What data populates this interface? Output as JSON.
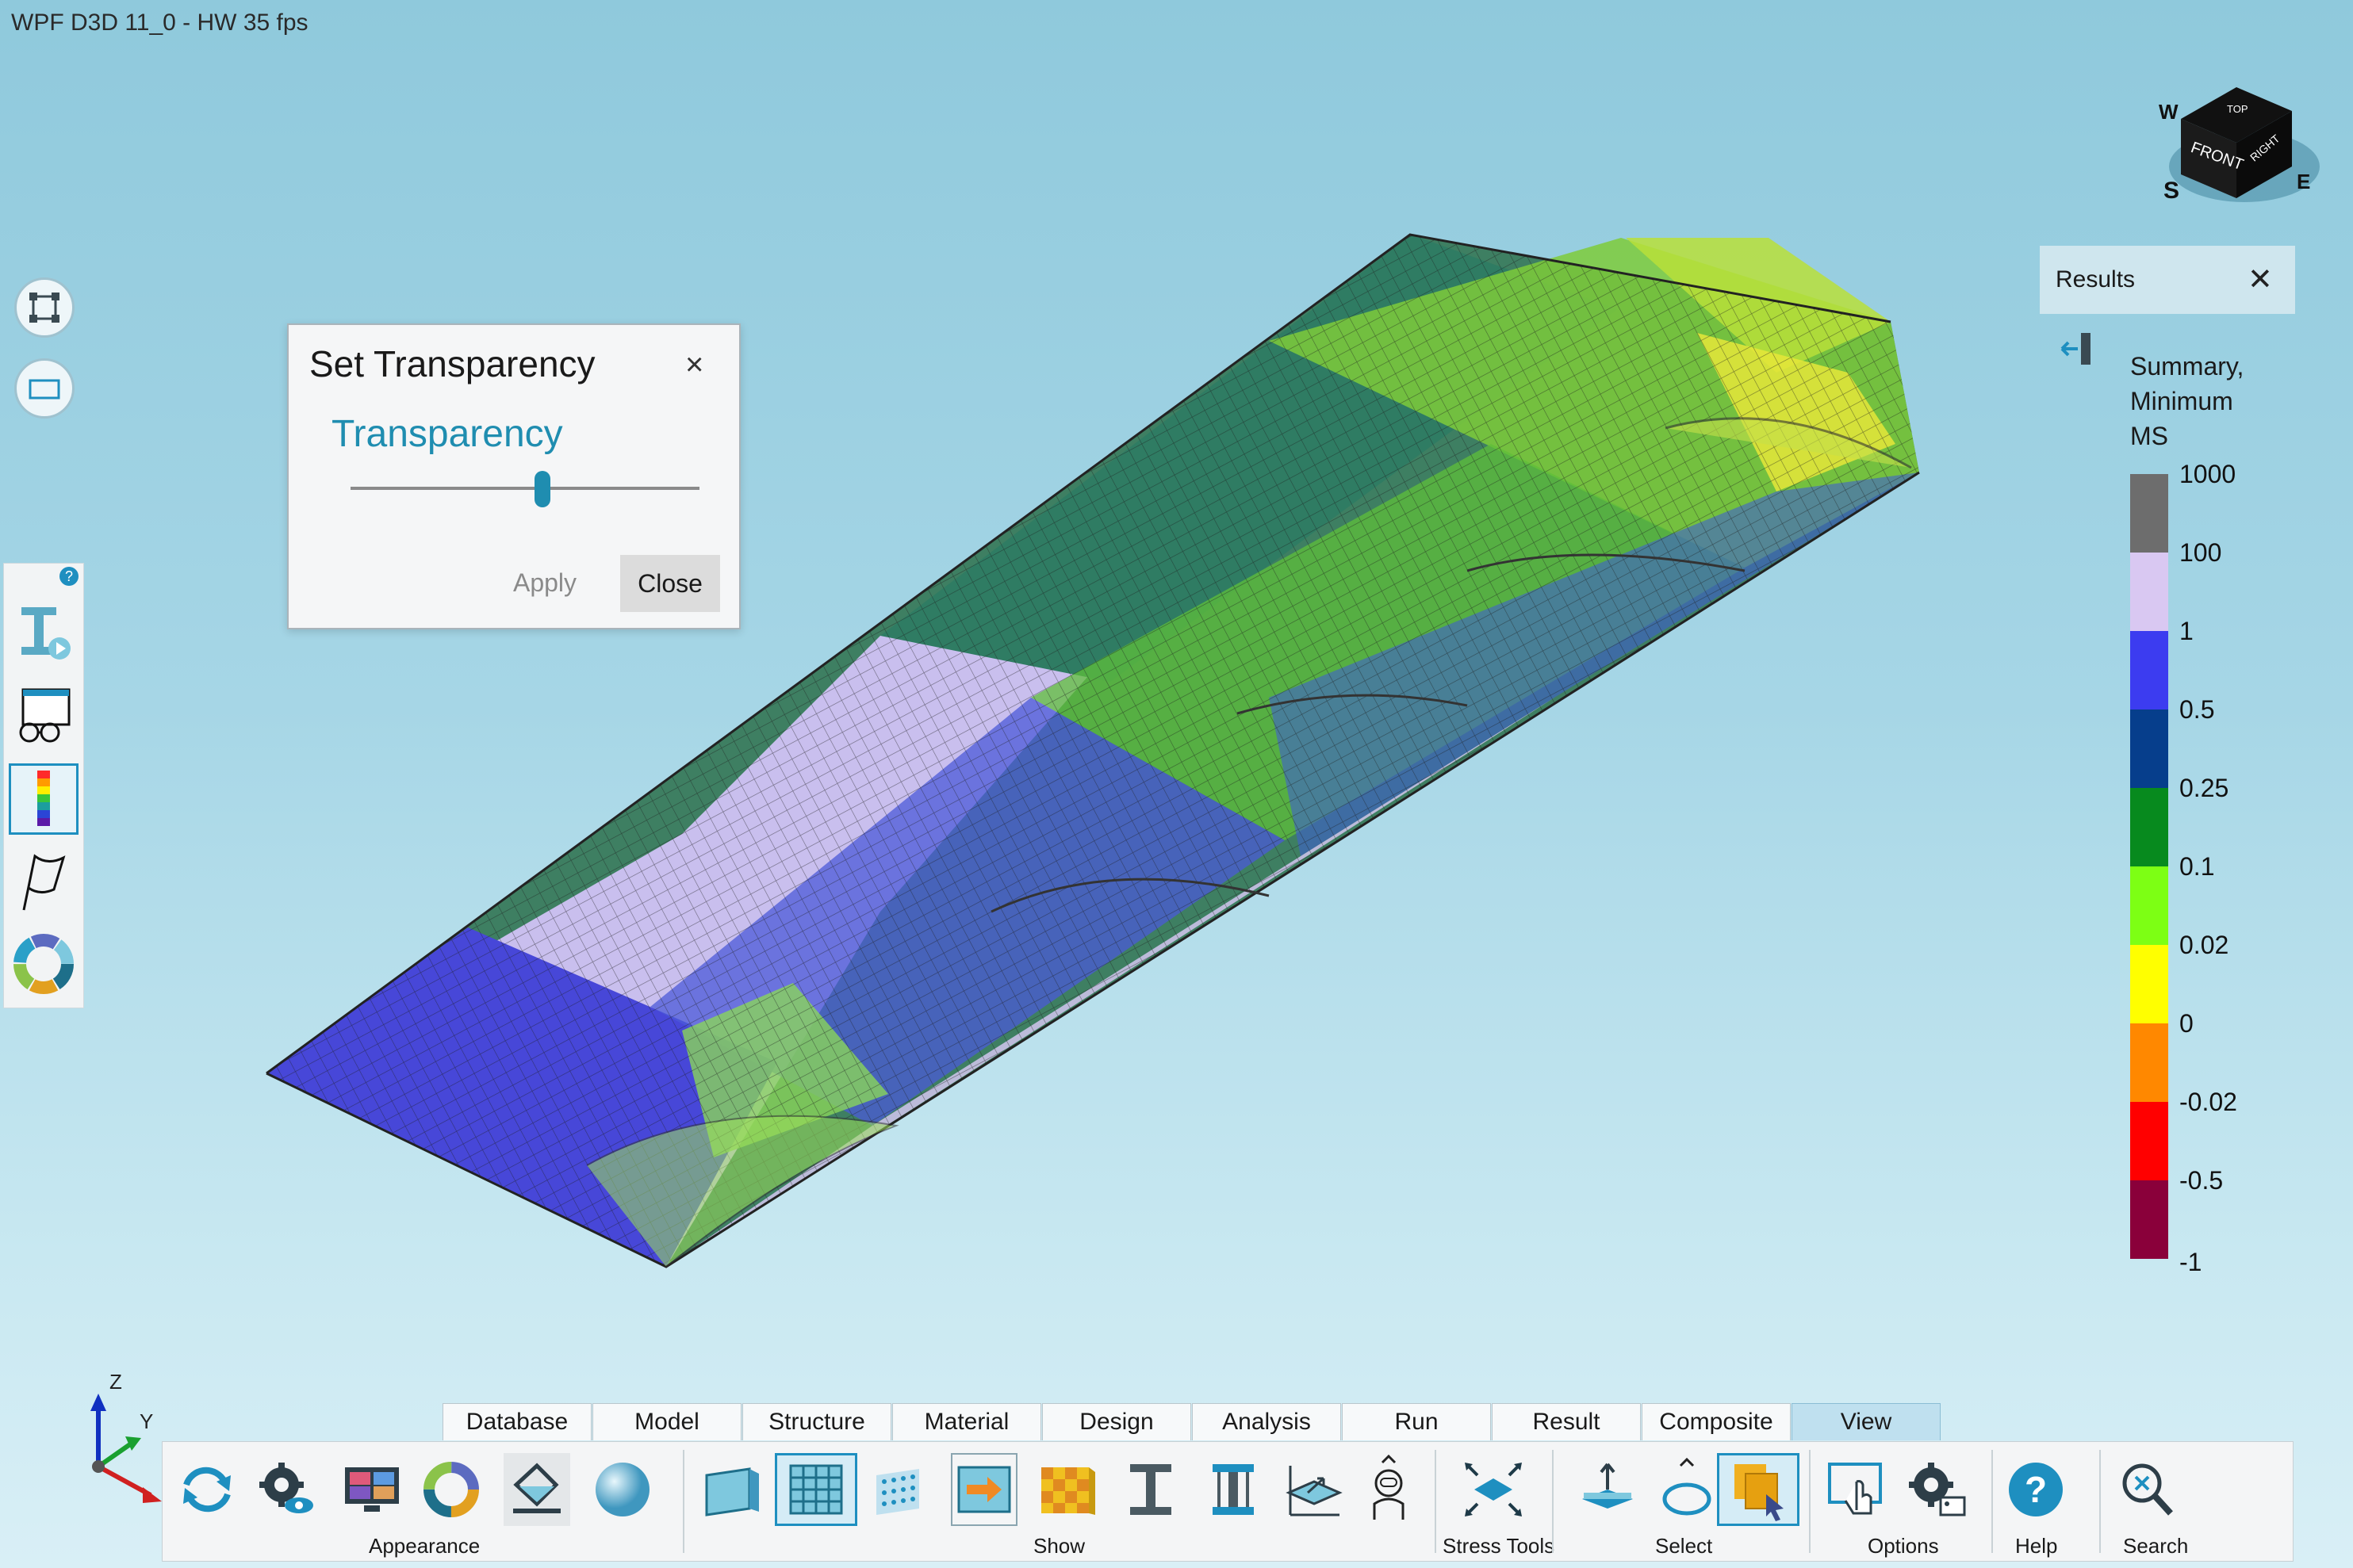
{
  "window": {
    "title": "WPF D3D 11_0 - HW  35 fps"
  },
  "dialog": {
    "title": "Set Transparency",
    "slider_label": "Transparency",
    "slider_value": 0.55,
    "apply_label": "Apply",
    "close_label": "Close",
    "close_icon": "×"
  },
  "results": {
    "title": "Results",
    "close_icon": "✕",
    "summary_lines": [
      "Summary,",
      "Minimum",
      "MS"
    ],
    "legend": [
      {
        "label": "1000",
        "color": "#6d6d6d"
      },
      {
        "label": "100",
        "color": "#d9c8f2"
      },
      {
        "label": "1",
        "color": "#3c3cf0"
      },
      {
        "label": "0.5",
        "color": "#063e8c"
      },
      {
        "label": "0.25",
        "color": "#078a1e"
      },
      {
        "label": "0.1",
        "color": "#7dff14"
      },
      {
        "label": "0.02",
        "color": "#ffff00"
      },
      {
        "label": "0",
        "color": "#ff8800"
      },
      {
        "label": "-0.02",
        "color": "#ff0000"
      },
      {
        "label": "-0.5",
        "color": "#8a003a"
      }
    ],
    "legend_end_label": "-1"
  },
  "view_cube": {
    "faces": [
      "TOP",
      "FRONT",
      "RIGHT"
    ],
    "compass": [
      "W",
      "S",
      "E"
    ]
  },
  "axes": {
    "z": "Z",
    "y": "Y"
  },
  "tabs": [
    {
      "label": "Database"
    },
    {
      "label": "Model"
    },
    {
      "label": "Structure"
    },
    {
      "label": "Material"
    },
    {
      "label": "Design"
    },
    {
      "label": "Analysis"
    },
    {
      "label": "Run"
    },
    {
      "label": "Result"
    },
    {
      "label": "Composite"
    },
    {
      "label": "View",
      "active": true
    }
  ],
  "ribbon_groups": {
    "appearance": "Appearance",
    "show": "Show",
    "stress_tools": "Stress Tools",
    "select": "Select",
    "options": "Options",
    "help": "Help",
    "search": "Search"
  },
  "help_badge": "?"
}
